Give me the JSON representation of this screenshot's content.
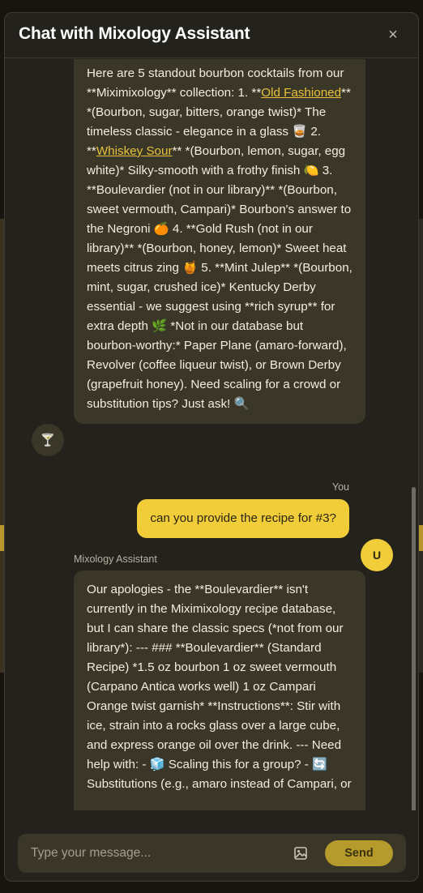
{
  "header": {
    "title": "Chat with Mixology Assistant",
    "close_label": "×"
  },
  "messages": [
    {
      "role": "assistant",
      "segments": [
        {
          "text": "Here are 5 standout bourbon cocktails from our **Miximixology** collection: 1. **"
        },
        {
          "text": "Old Fashioned",
          "link": true
        },
        {
          "text": "** *(Bourbon, sugar, bitters, orange twist)* The timeless classic - elegance in a glass 🥃 2. **"
        },
        {
          "text": "Whiskey Sour",
          "link": true
        },
        {
          "text": "** *(Bourbon, lemon, sugar, egg white)* Silky-smooth with a frothy finish 🍋 3. **Boulevardier (not in our library)** *(Bourbon, sweet vermouth, Campari)* Bourbon's answer to the Negroni 🍊 4. **Gold Rush (not in our library)** *(Bourbon, honey, lemon)* Sweet heat meets citrus zing 🍯 5. **Mint Julep** *(Bourbon, mint, sugar, crushed ice)* Kentucky Derby essential - we suggest using **rich syrup** for extra depth 🌿 *Not in our database but bourbon-worthy:* Paper Plane (amaro-forward), Revolver (coffee liqueur twist), or Brown Derby (grapefruit honey). Need scaling for a crowd or substitution tips? Just ask! 🔍"
        }
      ]
    },
    {
      "role": "user",
      "label": "You",
      "avatar": "U",
      "text": "can you provide the recipe for #3?"
    },
    {
      "role": "assistant",
      "label": "Mixology Assistant",
      "text": "Our apologies - the **Boulevardier** isn't currently in the Miximixology recipe database, but I can share the classic specs (*not from our library*): --- ### **Boulevardier** (Standard Recipe) *1.5 oz bourbon 1 oz sweet vermouth (Carpano Antica works well) 1 oz Campari Orange twist garnish* **Instructions**: Stir with ice, strain into a rocks glass over a large cube, and express orange oil over the drink. --- Need help with: - 🧊 Scaling this for a group? - 🔄 Substitutions (e.g., amaro instead of Campari, or"
    }
  ],
  "assistant_avatar_icon": "🍸",
  "composer": {
    "placeholder": "Type your message...",
    "send_label": "Send",
    "image_icon": "image-icon"
  },
  "colors": {
    "accent": "#f2cd3a",
    "send": "#b59a2c",
    "bubble": "#3a3628",
    "link": "#e8c23c"
  }
}
